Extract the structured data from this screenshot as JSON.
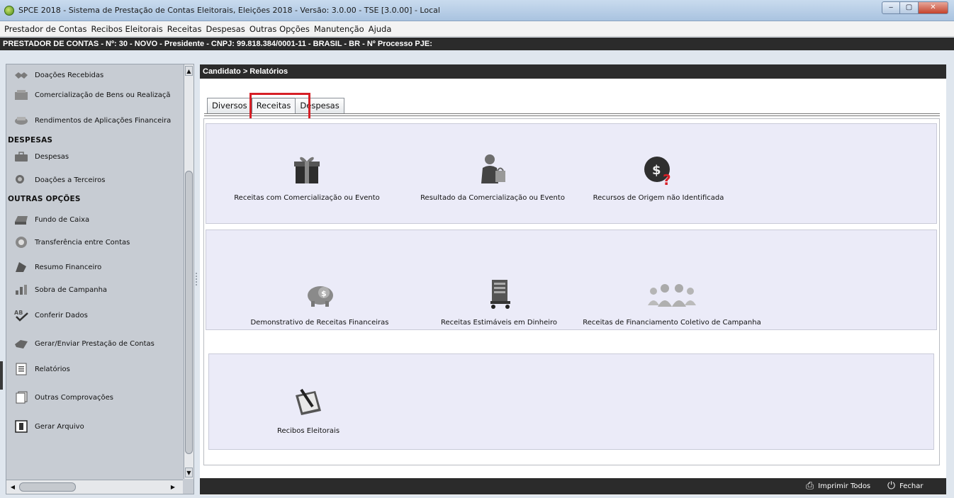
{
  "window": {
    "title": "SPCE 2018 - Sistema de Prestação de Contas Eleitorais, Eleições 2018 - Versão: 3.0.00  -  TSE [3.0.00] - Local",
    "min": "‒",
    "max": "▢",
    "close": "✕"
  },
  "menu": {
    "items": [
      "Prestador de Contas",
      "Recibos Eleitorais",
      "Receitas",
      "Despesas",
      "Outras Opções",
      "Manutenção",
      "Ajuda"
    ]
  },
  "infobar": {
    "text": "PRESTADOR DE CONTAS - Nº: 30 - NOVO - Presidente - CNPJ: 99.818.384/0001-11 - BRASIL - BR - Nº Processo PJE:"
  },
  "sidebar": {
    "items": [
      {
        "label": "Doações Recebidas",
        "icon": "handshake-icon",
        "color": "#7a7a7a"
      },
      {
        "label": "Comercialização de Bens ou Realizaçã",
        "icon": "cash-register-icon",
        "color": "#8a8a8a"
      },
      {
        "label": "Rendimentos de Aplicações Financeira",
        "icon": "money-hand-icon",
        "color": "#8a8a8a"
      },
      {
        "label": "Despesas",
        "icon": "briefcase-icon",
        "color": "#6f6f6f"
      },
      {
        "label": "Doações a Terceiros",
        "icon": "donation-icon",
        "color": "#6a6a6a"
      },
      {
        "label": "Fundo de Caixa",
        "icon": "cash-drawer-icon",
        "color": "#777777"
      },
      {
        "label": "Transferência entre Contas",
        "icon": "transfer-icon",
        "color": "#888888"
      },
      {
        "label": "Resumo Financeiro",
        "icon": "summary-icon",
        "color": "#555555"
      },
      {
        "label": "Sobra de Campanha",
        "icon": "surplus-icon",
        "color": "#666666"
      },
      {
        "label": "Conferir Dados",
        "icon": "spellcheck-icon",
        "color": "#555555"
      },
      {
        "label": "Gerar/Enviar Prestação de Contas",
        "icon": "send-icon",
        "color": "#666666"
      },
      {
        "label": "Relatórios",
        "icon": "report-icon",
        "color": "#777777"
      },
      {
        "label": "Outras Comprovações",
        "icon": "documents-icon",
        "color": "#777777"
      },
      {
        "label": "Gerar Arquivo",
        "icon": "file-icon",
        "color": "#444444"
      }
    ],
    "headings": {
      "despesas": "DESPESAS",
      "outras": "OUTRAS OPÇÕES"
    }
  },
  "main": {
    "breadcrumb": "Candidato > Relatórios",
    "tabs": [
      {
        "label": "Diversos",
        "active": false
      },
      {
        "label": "Receitas",
        "active": true
      },
      {
        "label": "Despesas",
        "active": false
      }
    ],
    "tiles": {
      "t1": {
        "label": "Receitas com Comercialização ou Evento",
        "icon": "gift-icon"
      },
      "t2": {
        "label": "Resultado da Comercialização ou Evento",
        "icon": "shopper-icon"
      },
      "t3": {
        "label": "Recursos de Origem não Identificada",
        "icon": "money-bag-question-icon"
      },
      "t4": {
        "label": "Demonstrativo de Receitas Financeiras",
        "icon": "piggy-bank-icon"
      },
      "t5": {
        "label": "Receitas Estimáveis em Dinheiro",
        "icon": "cart-icon"
      },
      "t6": {
        "label": "Receitas de Financiamento Coletivo de Campanha",
        "icon": "crowd-icon"
      },
      "t7": {
        "label": "Recibos Eleitorais",
        "icon": "receipt-pen-icon"
      }
    }
  },
  "footer": {
    "print_all": "Imprimir Todos",
    "close": "Fechar"
  },
  "colors": {
    "highlight": "#d61f26",
    "section_bg": "#ebebf8",
    "dark_bar": "#2b2b2b"
  }
}
